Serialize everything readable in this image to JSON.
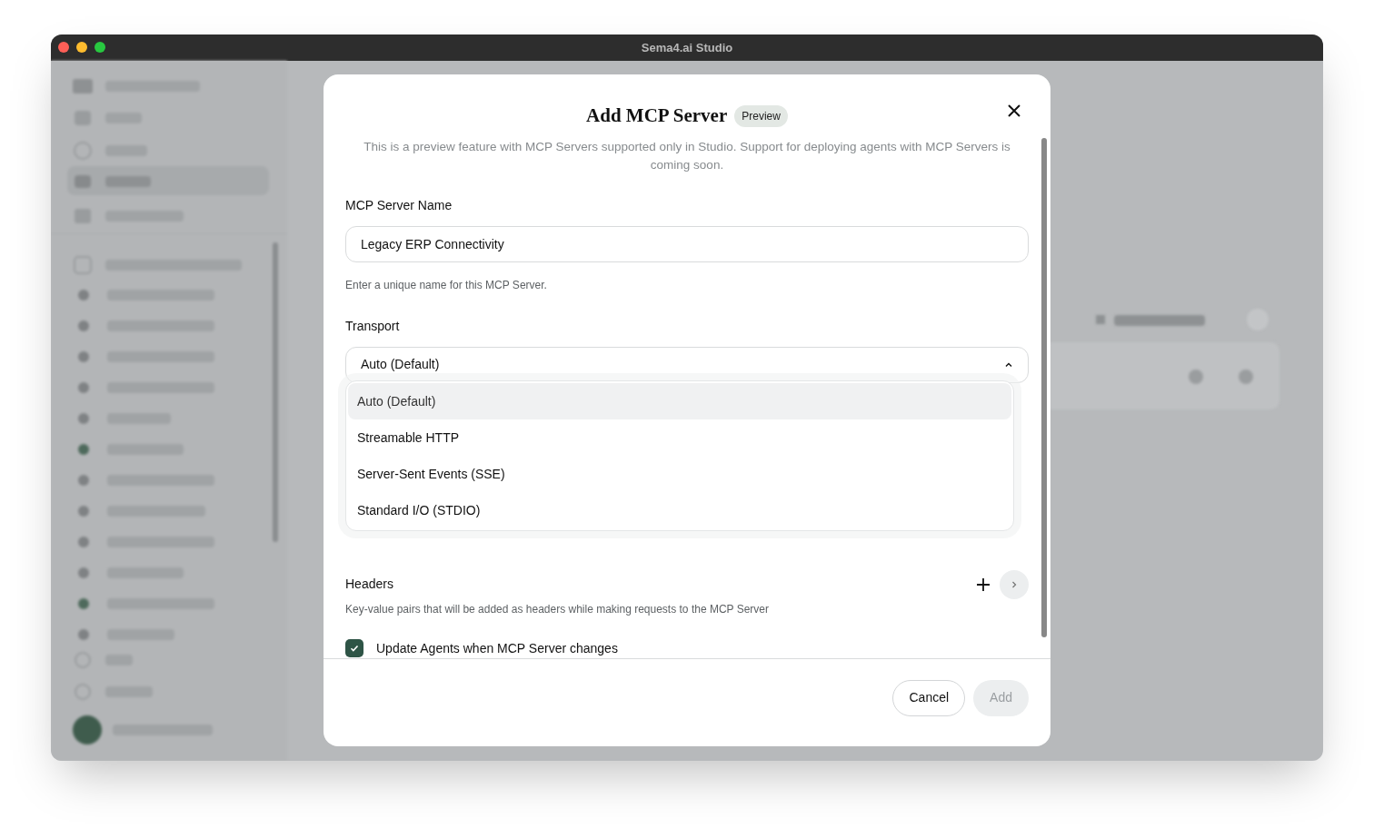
{
  "window": {
    "title": "Sema4.ai Studio"
  },
  "dialog": {
    "title": "Add MCP Server",
    "badge": "Preview",
    "description": "This is a preview feature with MCP Servers supported only in Studio. Support for deploying agents with MCP Servers is coming soon.",
    "name_field": {
      "label": "MCP Server Name",
      "value": "Legacy ERP Connectivity",
      "hint": "Enter a unique name for this MCP Server."
    },
    "transport": {
      "label": "Transport",
      "value": "Auto (Default)",
      "expanded": true,
      "options": [
        {
          "label": "Auto (Default)",
          "selected": true
        },
        {
          "label": "Streamable HTTP",
          "selected": false
        },
        {
          "label": "Server-Sent Events (SSE)",
          "selected": false
        },
        {
          "label": "Standard I/O (STDIO)",
          "selected": false
        }
      ]
    },
    "headers": {
      "label": "Headers",
      "hint": "Key-value pairs that will be added as headers while making requests to the MCP Server"
    },
    "update_agents": {
      "label": "Update Agents when MCP Server changes",
      "checked": true
    },
    "buttons": [
      {
        "label": "Cancel",
        "disabled": false
      },
      {
        "label": "Add",
        "disabled": true
      }
    ]
  }
}
